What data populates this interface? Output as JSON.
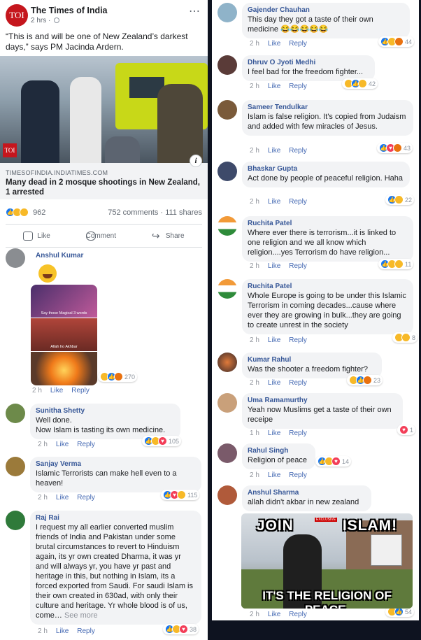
{
  "colors": {
    "facebook_blue": "#4267b2",
    "toi_red": "#c5161d",
    "bubble_gray": "#f2f3f5",
    "like_blue": "#1877f2",
    "love_red": "#f33e58",
    "haha_yellow": "#f7b928"
  },
  "post": {
    "page_name": "The Times of India",
    "page_logo_text": "TOI",
    "time": "2 hrs",
    "more_icon": "⋯",
    "text": "“This is and will be one of New Zealand’s darkest days,” says PM Jacinda Ardern.",
    "image_badge": "TOI",
    "link_source": "TIMESOFINDIA.INDIATIMES.COM",
    "link_title": "Many dead in 2 mosque shootings in New Zealand, 1 arrested",
    "reaction_count": "962",
    "reaction_icons": [
      "like-icon",
      "sad-icon",
      "haha-icon"
    ],
    "comments_count": "752 comments",
    "shares_count": "111 shares",
    "actions": {
      "like": "Like",
      "comment": "Comment",
      "share": "Share"
    }
  },
  "meme_left": {
    "caption_top": "Say those Magical 3 words",
    "caption_mid": "Allah ho Akhbar"
  },
  "meme_right": {
    "top_left": "JOIN",
    "top_right": "ISLAM!",
    "badge": "EXCLUSIVE",
    "bottom": "IT'S THE RELIGION OF PEACE."
  },
  "left_comments": [
    {
      "name": "Anshul Kumar",
      "text": "",
      "time": "2 h",
      "like": "Like",
      "reply": "Reply",
      "reactions": "270"
    },
    {
      "name": "Sunitha Shetty",
      "text": "Well done.\nNow Islam is tasting its own medicine.",
      "time": "2 h",
      "like": "Like",
      "reply": "Reply",
      "reactions": "105"
    },
    {
      "name": "Sanjay Verma",
      "text": "Islamic Terrorists can make hell even to a heaven!",
      "time": "2 h",
      "like": "Like",
      "reply": "Reply",
      "reactions": "115"
    },
    {
      "name": "Raj Rai",
      "text": "I request my all earlier converted muslim friends of India and Pakistan under some brutal circumstances to revert to Hinduism again, its yr own created Dharma, it was yr and will always yr, you have yr past and heritage in this, but nothing in Islam, its a forced exported from Saudi. For saudi Islam is their own created in 630ad, with only their culture and heritage. Yr whole blood is of us, come…",
      "see_more": "See more",
      "time": "2 h",
      "like": "Like",
      "reply": "Reply",
      "reactions": "38"
    }
  ],
  "right_comments": [
    {
      "name": "Gajender Chauhan",
      "text": "This day they got a taste of their own medicine 😂😂😂😂😂",
      "time": "2 h",
      "like": "Like",
      "reply": "Reply",
      "reactions": "44"
    },
    {
      "name": "Dhruv O Jyoti Medhi",
      "text": "I feel bad for the freedom fighter...",
      "time": "2 h",
      "like": "Like",
      "reply": "Reply",
      "reactions": "42"
    },
    {
      "name": "Sameer Tendulkar",
      "text": "Islam is false religion. It's copied from Judaism and added with few miracles of Jesus.",
      "time": "2 h",
      "like": "Like",
      "reply": "Reply",
      "reactions": "43"
    },
    {
      "name": "Bhaskar Gupta",
      "text": "Act done by people of peaceful religion. Haha",
      "time": "2 h",
      "like": "Like",
      "reply": "Reply",
      "reactions": "22"
    },
    {
      "name": "Ruchita Patel",
      "text": "Where ever there is terrorism...it is linked to one religion and we all know which religion....yes Terrorism do have religion...",
      "time": "2 h",
      "like": "Like",
      "reply": "Reply",
      "reactions": "11"
    },
    {
      "name": "Ruchita Patel",
      "text": "Whole Europe is going to be under this Islamic Terrorism in coming decades...cause where ever they are growing in bulk...they are going to create unrest in the society",
      "time": "2 h",
      "like": "Like",
      "reply": "Reply",
      "reactions": "8"
    },
    {
      "name": "Kumar Rahul",
      "text": "Was the shooter a freedom fighter?",
      "time": "2 h",
      "like": "Like",
      "reply": "Reply",
      "reactions": "23"
    },
    {
      "name": "Uma Ramamurthy",
      "text": "Yeah now Muslims get a taste of their own receipe",
      "time": "1 h",
      "like": "Like",
      "reply": "Reply",
      "reactions": "1"
    },
    {
      "name": "Rahul Singh",
      "text": "Religion of peace",
      "time": "2 h",
      "like": "Like",
      "reply": "Reply",
      "reactions": "14"
    },
    {
      "name": "Anshul Sharma",
      "text": "allah didn't akbar in new zealand",
      "time": "2 h",
      "like": "Like",
      "reply": "Reply",
      "reactions": "54"
    }
  ]
}
